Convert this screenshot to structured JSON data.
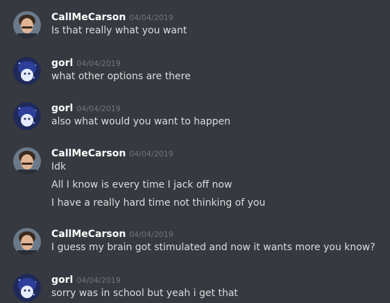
{
  "messages": [
    {
      "author": "CallMeCarson",
      "avatar": "carson-avatar-icon",
      "timestamp": "04/04/2019",
      "lines": [
        "Is that really what you want"
      ]
    },
    {
      "author": "gorl",
      "avatar": "gorl-avatar-icon",
      "timestamp": "04/04/2019",
      "lines": [
        "what other options are there"
      ]
    },
    {
      "author": "gorl",
      "avatar": "gorl-avatar-icon",
      "timestamp": "04/04/2019",
      "lines": [
        "also what would you want to happen"
      ]
    },
    {
      "author": "CallMeCarson",
      "avatar": "carson-avatar-icon",
      "timestamp": "04/04/2019",
      "lines": [
        "Idk",
        "All I know is every time I jack off now",
        "I have a really hard time not thinking of you"
      ]
    },
    {
      "author": "CallMeCarson",
      "avatar": "carson-avatar-icon",
      "timestamp": "04/04/2019",
      "lines": [
        "I guess my brain got stimulated and now it wants more you know?"
      ]
    },
    {
      "author": "gorl",
      "avatar": "gorl-avatar-icon",
      "timestamp": "04/04/2019",
      "lines": [
        "sorry was in school but yeah i get that"
      ]
    }
  ],
  "colors": {
    "background": "#36393f",
    "username": "#ffffff",
    "message_text": "#dcddde",
    "timestamp": "#72767d"
  }
}
